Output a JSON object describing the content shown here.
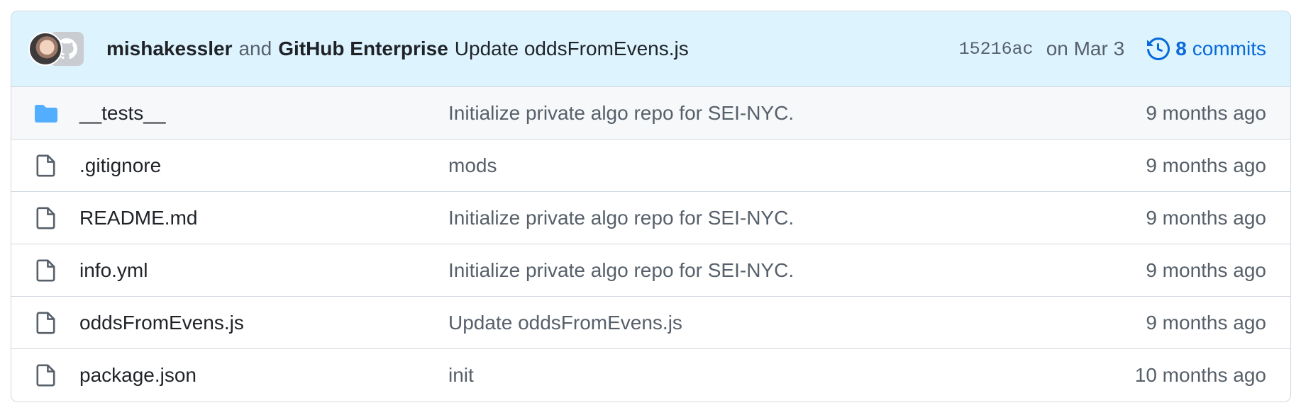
{
  "commit": {
    "author": "mishakessler",
    "joiner": "and",
    "coauthor": "GitHub Enterprise",
    "message": "Update oddsFromEvens.js",
    "sha": "15216ac",
    "date": "on Mar 3",
    "commits_count": "8",
    "commits_label": "commits"
  },
  "files": [
    {
      "icon": "folder-icon",
      "name": "__tests__",
      "message": "Initialize private algo repo for SEI-NYC.",
      "age": "9 months ago"
    },
    {
      "icon": "file-icon",
      "name": ".gitignore",
      "message": "mods",
      "age": "9 months ago"
    },
    {
      "icon": "file-icon",
      "name": "README.md",
      "message": "Initialize private algo repo for SEI-NYC.",
      "age": "9 months ago"
    },
    {
      "icon": "file-icon",
      "name": "info.yml",
      "message": "Initialize private algo repo for SEI-NYC.",
      "age": "9 months ago"
    },
    {
      "icon": "file-icon",
      "name": "oddsFromEvens.js",
      "message": "Update oddsFromEvens.js",
      "age": "9 months ago"
    },
    {
      "icon": "file-icon",
      "name": "package.json",
      "message": "init",
      "age": "10 months ago"
    }
  ],
  "colors": {
    "header_bg": "#ddf4ff",
    "link": "#0969da",
    "folder": "#54aeff",
    "muted": "#57606a",
    "border": "#d0d7de"
  }
}
